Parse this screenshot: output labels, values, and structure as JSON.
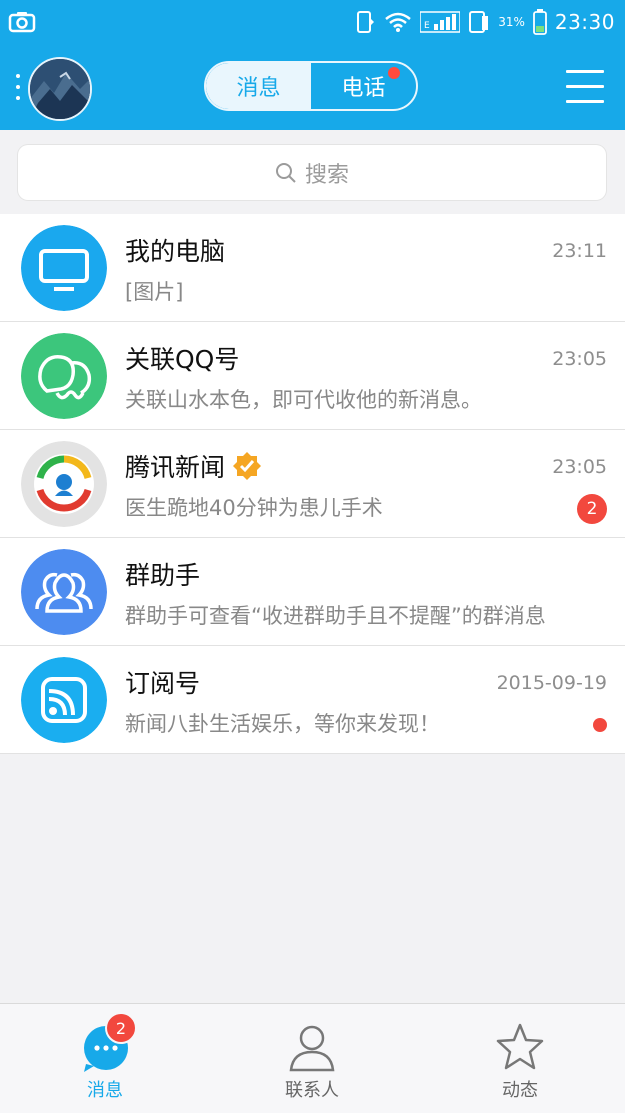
{
  "status_bar": {
    "battery_percent": "31%",
    "time": "23:30"
  },
  "header": {
    "tabs": [
      {
        "label": "消息",
        "active": true
      },
      {
        "label": "电话",
        "active": false,
        "has_dot": true
      }
    ]
  },
  "search": {
    "placeholder": "搜索"
  },
  "conversations": [
    {
      "title": "我的电脑",
      "subtitle": "[图片]",
      "time": "23:11",
      "icon": "monitor-icon",
      "color": "#1aa8ee"
    },
    {
      "title": "关联QQ号",
      "subtitle": "关联山水本色，即可代收他的新消息。",
      "time": "23:05",
      "icon": "linked-accounts-icon",
      "color": "#3cc67c"
    },
    {
      "title": "腾讯新闻",
      "subtitle": "医生跪地40分钟为患儿手术",
      "time": "23:05",
      "icon": "tencent-news-icon",
      "verified": true,
      "badge": "2"
    },
    {
      "title": "群助手",
      "subtitle": "群助手可查看“收进群助手且不提醒”的群消息",
      "time": "",
      "icon": "group-assistant-icon",
      "color": "#4d8cf0"
    },
    {
      "title": "订阅号",
      "subtitle": "新闻八卦生活娱乐，等你来发现！",
      "time": "2015-09-19",
      "icon": "rss-icon",
      "color": "#1aaef0",
      "red_dot": true
    }
  ],
  "tabbar": {
    "items": [
      {
        "label": "消息",
        "active": true,
        "badge": "2"
      },
      {
        "label": "联系人",
        "active": false
      },
      {
        "label": "动态",
        "active": false
      }
    ]
  },
  "colors": {
    "accent": "#17a9e9",
    "badge": "#f2483e"
  }
}
